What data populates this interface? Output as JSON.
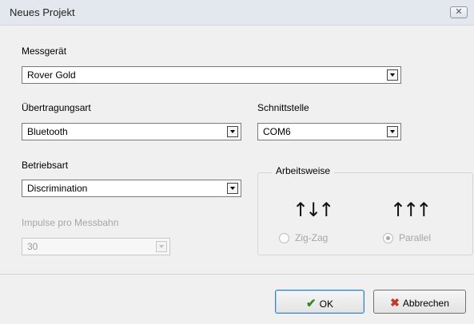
{
  "window": {
    "title": "Neues Projekt",
    "close_icon": "close-icon"
  },
  "device": {
    "label": "Messgerät",
    "value": "Rover Gold"
  },
  "transfer": {
    "label": "Übertragungsart",
    "value": "Bluetooth"
  },
  "interface": {
    "label": "Schnittstelle",
    "value": "COM6"
  },
  "operation": {
    "label": "Betriebsart",
    "value": "Discrimination"
  },
  "pulses": {
    "label": "Impulse pro Messbahn",
    "value": "30"
  },
  "work_mode": {
    "title": "Arbeitsweise",
    "zigzag": {
      "label": "Zig-Zag",
      "icon": "↑↓↑",
      "checked": false
    },
    "parallel": {
      "label": "Parallel",
      "icon": "↑↑↑",
      "checked": true
    }
  },
  "buttons": {
    "ok": {
      "label": "OK",
      "icon": "✔"
    },
    "cancel": {
      "label": "Abbrechen",
      "icon": "✖"
    }
  }
}
